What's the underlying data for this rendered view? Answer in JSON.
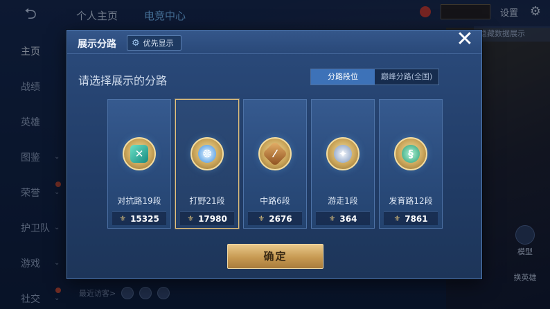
{
  "app": {
    "top_tabs": [
      "个人主页",
      "电竞中心"
    ],
    "settings_label": "设置",
    "hidden_button_label": "隐藏数据展示",
    "side_nav": [
      {
        "label": "主页",
        "active": true
      },
      {
        "label": "战绩"
      },
      {
        "label": "英雄"
      },
      {
        "label": "图鉴",
        "chevron": true
      },
      {
        "label": "荣誉",
        "chevron": true,
        "dot": true
      },
      {
        "label": "护卫队",
        "chevron": true
      },
      {
        "label": "游戏",
        "chevron": true
      },
      {
        "label": "社交",
        "chevron": true,
        "dot": true
      }
    ],
    "recent_visitors_label": "最近访客>",
    "right_buttons": [
      "模型",
      "换英雄"
    ]
  },
  "dialog": {
    "title": "展示分路",
    "priority_button": "优先显示",
    "prompt": "请选择展示的分路",
    "segments": [
      {
        "label": "分路段位",
        "active": true
      },
      {
        "label": "巅峰分路(全国)",
        "active": false
      }
    ],
    "lanes": [
      {
        "label": "对抗路19段",
        "score": "15325",
        "icon": "clash-lane-emblem-icon",
        "glyph": "✕",
        "style": "teal",
        "selected": false
      },
      {
        "label": "打野21段",
        "score": "17980",
        "icon": "jungle-emblem-icon",
        "glyph": "❂",
        "style": "blue",
        "selected": true
      },
      {
        "label": "中路6段",
        "score": "2676",
        "icon": "mid-lane-emblem-icon",
        "glyph": "⁄",
        "style": "gold",
        "selected": false
      },
      {
        "label": "游走1段",
        "score": "364",
        "icon": "roam-emblem-icon",
        "glyph": "✦",
        "style": "silver",
        "selected": false
      },
      {
        "label": "发育路12段",
        "score": "7861",
        "icon": "farm-lane-emblem-icon",
        "glyph": "§",
        "style": "green",
        "selected": false
      }
    ],
    "confirm_label": "确定"
  },
  "colors": {
    "dialog_bg": "#2b4b7c",
    "selected_border": "#e5c27b",
    "confirm_gold": "#c79a52",
    "segment_active": "#3d72b8"
  }
}
